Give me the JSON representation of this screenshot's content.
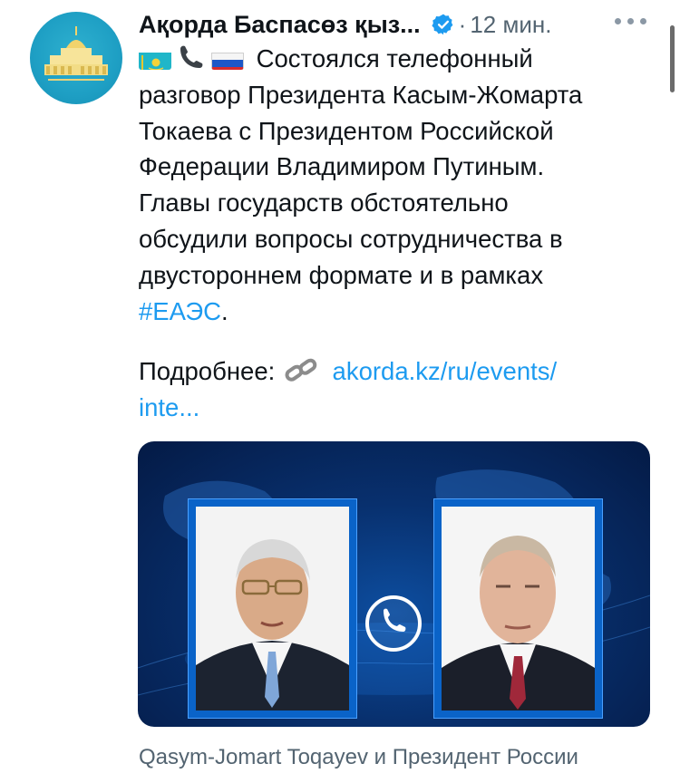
{
  "tweet": {
    "author": "Ақорда Баспасөз қыз...",
    "separator": "·",
    "time": "12 мин.",
    "text_line1": "Состоялся телефонный",
    "text_line2": "разговор Президента Касым-Жомарта",
    "text_line3": "Токаева с Президентом Российской",
    "text_line4": "Федерации Владимиром Путиным.",
    "text_line5": "Главы государств обстоятельно",
    "text_line6": "обсудили вопросы сотрудничества в",
    "text_line7": "двустороннем формате и в рамках",
    "hashtag": "#ЕАЭС",
    "hashtag_end": ".",
    "detail_label": "Подробнее:",
    "link_line1": "akorda.kz/ru/events/",
    "link_line2": "inte...",
    "card_caption": "Qasym-Jomart Toqayev и Президент России"
  },
  "colors": {
    "link": "#1d9bf0",
    "text": "#0f1419",
    "muted": "#536471",
    "verified": "#1d9bf0",
    "media_bg": "#08306e"
  },
  "icons": {
    "verified": "verified-badge-icon",
    "more": "more-dots-icon",
    "chain": "link-chain-icon",
    "phone": "telephone-icon",
    "kz_flag": "kazakhstan-flag-icon",
    "ru_flag": "russia-flag-icon"
  }
}
